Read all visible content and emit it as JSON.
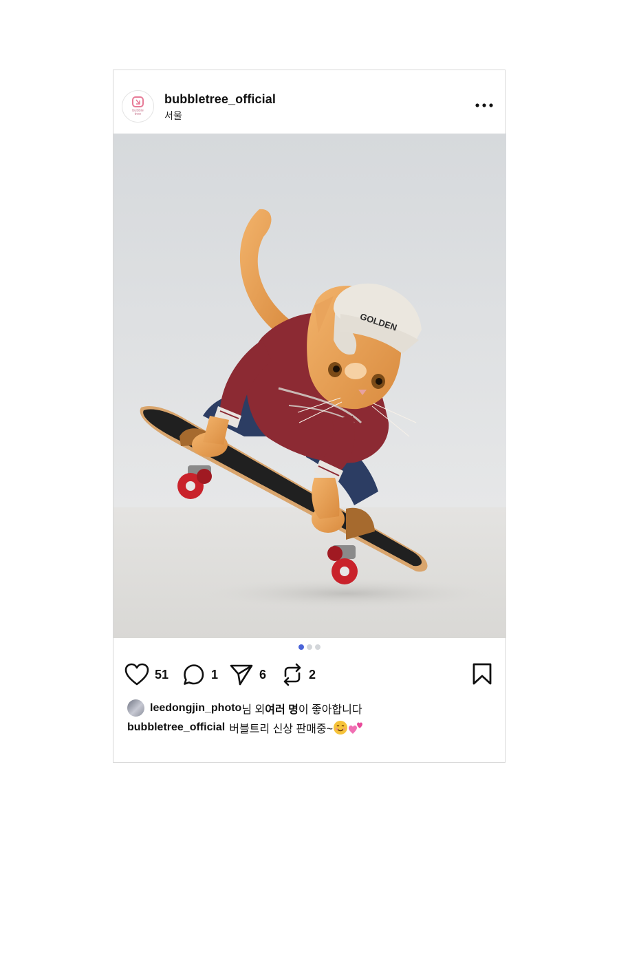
{
  "post": {
    "username": "bubbletree_official",
    "location": "서울",
    "avatar_logo_text": "bubble tree",
    "image_cap_text": "GOLDEN",
    "carousel": {
      "total": 3,
      "active": 1
    },
    "actions": {
      "likes_count": "51",
      "comments_count": "1",
      "shares_count": "6",
      "reposts_count": "2"
    },
    "liked_by": {
      "username": "leedongjin_photo",
      "middle_text": "님 외 ",
      "bold_text": "여러 명",
      "suffix": "이 좋아합니다"
    },
    "caption": {
      "username": "bubbletree_official",
      "text": "버블트리 신상 판매중~"
    },
    "icons": [
      "more-icon",
      "heart-icon",
      "comment-icon",
      "send-icon",
      "repost-icon",
      "bookmark-icon",
      "smile-emoji",
      "hearts-emoji"
    ],
    "colors": {
      "accent_dot": "#4a64d8",
      "logo_pink": "#e77b97"
    }
  }
}
